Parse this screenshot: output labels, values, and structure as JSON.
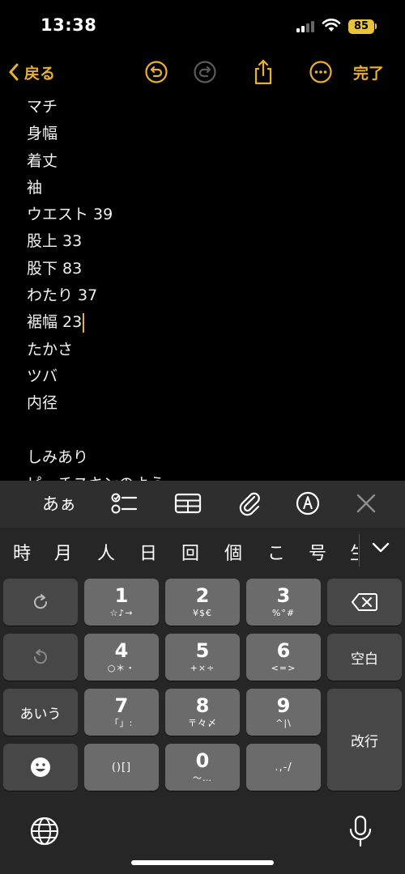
{
  "status": {
    "time": "13:38",
    "battery": "85"
  },
  "nav": {
    "back_label": "戻る",
    "done_label": "完了"
  },
  "note": {
    "lines": [
      "マチ",
      "身幅",
      "着丈",
      "袖",
      "ウエスト 39",
      "股上 33",
      "股下 83",
      "わたり 37",
      "裾幅 23",
      "たかさ",
      "ツバ",
      "内径",
      "",
      "しみあり",
      "ピーチスキンのよう"
    ]
  },
  "toolbar": {
    "aa_label": "あぁ"
  },
  "candidates": [
    "時",
    "月",
    "人",
    "日",
    "回",
    "個",
    "こ",
    "号",
    "生"
  ],
  "keys": {
    "k1": {
      "main": "1",
      "sub": "☆♪→"
    },
    "k2": {
      "main": "2",
      "sub": "¥$€"
    },
    "k3": {
      "main": "3",
      "sub": "%°#"
    },
    "k4": {
      "main": "4",
      "sub": "○＊・"
    },
    "k5": {
      "main": "5",
      "sub": "+×÷"
    },
    "k6": {
      "main": "6",
      "sub": "<=>"
    },
    "k7": {
      "main": "7",
      "sub": "「」:"
    },
    "k8": {
      "main": "8",
      "sub": "〒々〆"
    },
    "k9": {
      "main": "9",
      "sub": "^|\\"
    },
    "k0": {
      "main": "0",
      "sub": "〜…"
    },
    "brackets": "()[]",
    "punct": ".,-/",
    "space": "空白",
    "kana": "あいう",
    "enter": "改行"
  },
  "colors": {
    "accent": "#e9b12e",
    "battery": "#e9c33b",
    "key": "#6b6b6b",
    "key_dark": "#474747"
  }
}
